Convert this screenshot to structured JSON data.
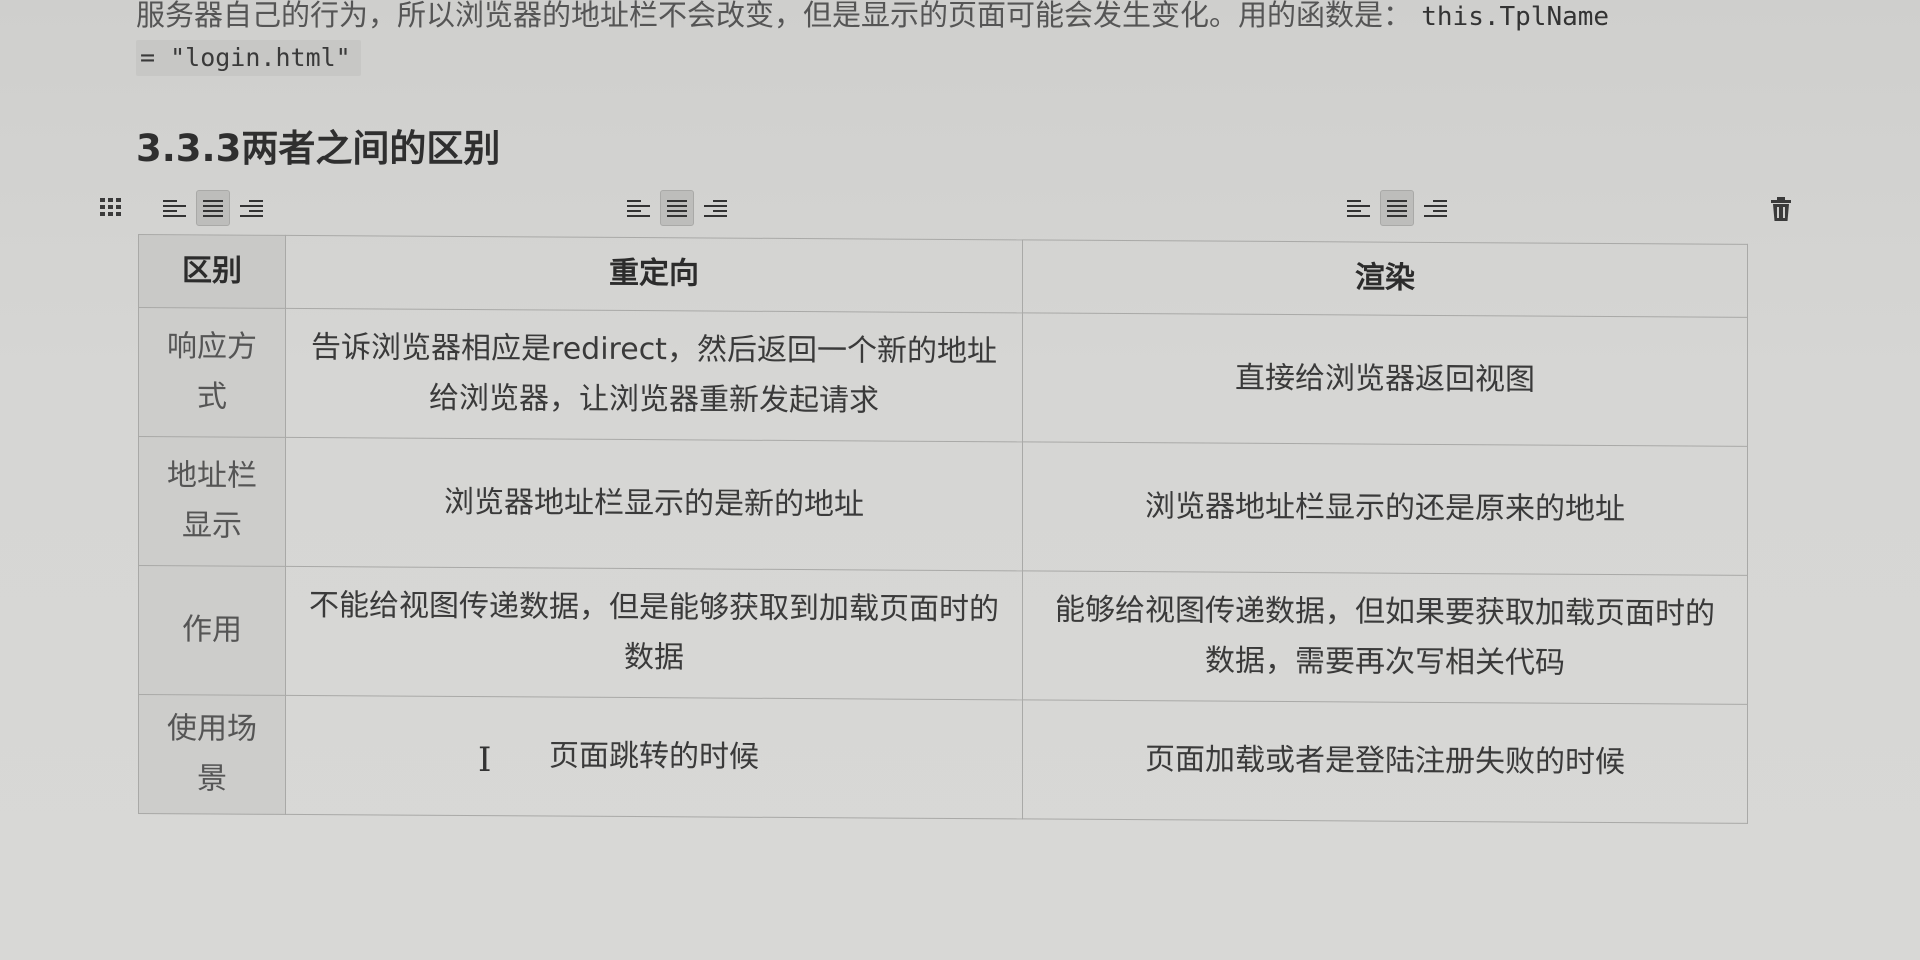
{
  "intro": {
    "text": "服务器自己的行为，所以浏览器的地址栏不会改变，但是显示的页面可能会发生变化。用的函数是：",
    "code_inline": "this.TplName",
    "code_chip": "= \"login.html\""
  },
  "section": {
    "title": "3.3.3两者之间的区别"
  },
  "table": {
    "headers": [
      "区别",
      "重定向",
      "渲染"
    ],
    "rows": [
      {
        "label": "响应方式",
        "redirect": "告诉浏览器相应是redirect，然后返回一个新的地址给浏览器，让浏览器重新发起请求",
        "render": "直接给浏览器返回视图"
      },
      {
        "label": "地址栏显示",
        "redirect": "浏览器地址栏显示的是新的地址",
        "render": "浏览器地址栏显示的还是原来的地址"
      },
      {
        "label": "作用",
        "redirect": "不能给视图传递数据，但是能够获取到加载页面时的数据",
        "render": "能够给视图传递数据，但如果要获取加载页面时的数据，需要再次写相关代码"
      },
      {
        "label": "使用场景",
        "redirect": "页面跳转的时候",
        "render": "页面加载或者是登陆注册失败的时候"
      }
    ]
  },
  "icons": {
    "grip": "table-grip-icon",
    "align_left": "align-left-icon",
    "align_center": "align-center-icon",
    "align_right": "align-right-icon",
    "delete": "trash-icon",
    "cursor": "text-cursor-icon"
  }
}
